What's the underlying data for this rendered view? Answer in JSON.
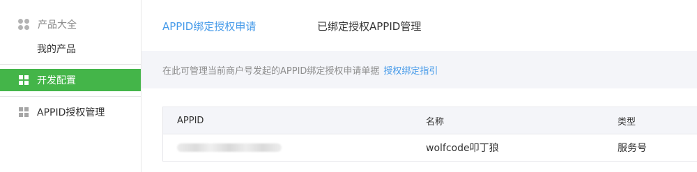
{
  "sidebar": {
    "group_title": "产品大全",
    "group_sub_item": "我的产品",
    "items": [
      {
        "label": "开发配置",
        "active": true,
        "icon": "grid-icon"
      },
      {
        "label": "APPID授权管理",
        "active": false,
        "icon": "grid-icon"
      }
    ]
  },
  "tabs": [
    {
      "label": "APPID绑定授权申请",
      "active": true
    },
    {
      "label": "已绑定授权APPID管理",
      "active": false
    }
  ],
  "notice": {
    "text": "在此可管理当前商户号发起的APPID绑定授权申请单据",
    "link_label": "授权绑定指引"
  },
  "table": {
    "columns": [
      "APPID",
      "名称",
      "类型"
    ],
    "rows": [
      {
        "appid": "",
        "name": "wolfcode叩丁狼",
        "type": "服务号"
      }
    ]
  },
  "colors": {
    "accent_green": "#44b549",
    "link_blue": "#459ae9",
    "notice_bg": "#f4f5f9"
  }
}
